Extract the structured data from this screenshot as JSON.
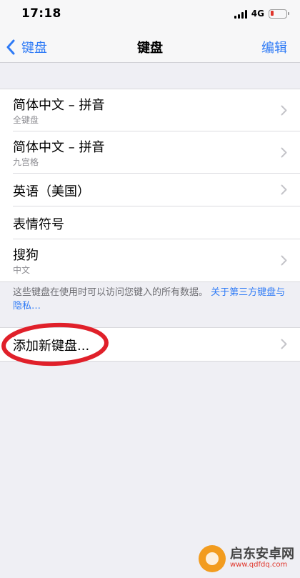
{
  "status_bar": {
    "time": "17:18",
    "network": "4G"
  },
  "nav": {
    "back_label": "键盘",
    "title": "键盘",
    "edit_label": "编辑"
  },
  "keyboards": [
    {
      "title": "简体中文 – 拼音",
      "subtitle": "全键盘"
    },
    {
      "title": "简体中文 – 拼音",
      "subtitle": "九宫格"
    },
    {
      "title": "英语（美国）",
      "subtitle": ""
    },
    {
      "title": "表情符号",
      "subtitle": ""
    },
    {
      "title": "搜狗",
      "subtitle": "中文"
    }
  ],
  "footer": {
    "note": "这些键盘在使用时可以访问您键入的所有数据。",
    "link": "关于第三方键盘与隐私…"
  },
  "add_keyboard": {
    "label": "添加新键盘..."
  },
  "watermark": {
    "brand": "启东安卓网",
    "url": "www.qdfdq.com"
  },
  "colors": {
    "accent": "#2f7bf6",
    "background": "#efeff4",
    "highlight_circle": "#e0202a",
    "battery_low": "#e0352b"
  },
  "icons": {
    "back": "chevron-left-icon",
    "disclosure": "chevron-right-icon",
    "signal": "cellular-signal-icon",
    "battery": "battery-icon"
  }
}
